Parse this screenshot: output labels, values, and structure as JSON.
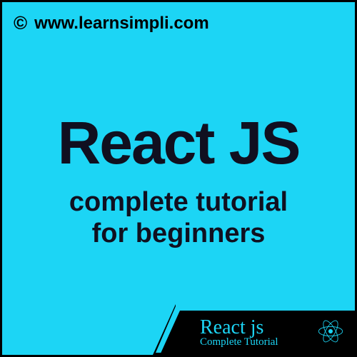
{
  "header": {
    "copyright": "©",
    "url": "www.learnsimpli.com"
  },
  "main": {
    "title": "React JS",
    "subtitle_line1": "complete tutorial",
    "subtitle_line2": "for beginners"
  },
  "badge": {
    "title": "React js",
    "subtitle": "Complete Tutorial"
  },
  "colors": {
    "background": "#1cd5f5",
    "text": "#000000",
    "badge_bg": "#000000",
    "badge_text": "#1cd5f5"
  }
}
